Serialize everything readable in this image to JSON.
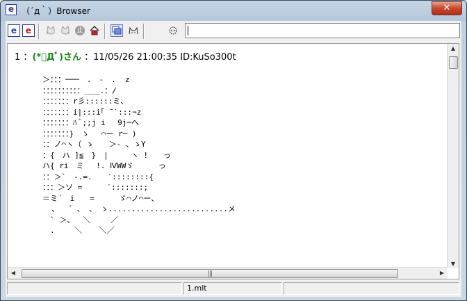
{
  "window": {
    "title": "（´д｀）Browser",
    "close_glyph": "✕",
    "app_icon_glyph": "e"
  },
  "toolbar": {
    "buttons": [
      {
        "name": "open-board-icon",
        "glyph": "e"
      },
      {
        "name": "open-thread-icon",
        "glyph": "e"
      },
      {
        "name": "back-cat-icon"
      },
      {
        "name": "forward-cat-icon"
      },
      {
        "name": "stop-icon",
        "glyph": "止"
      },
      {
        "name": "home-icon"
      },
      {
        "name": "monitor-icon"
      },
      {
        "name": "cat-face-icon"
      },
      {
        "name": "settings-icon"
      }
    ],
    "address_value": ""
  },
  "post": {
    "number": "1",
    "separator": "：",
    "name": "(*ﾟДﾟ)さん",
    "datetime": "11/05/26 21:00:35",
    "id": "ID:KuSo300t"
  },
  "ascii_art": [
    "＞：：：───　.　-　.  z",
    "：：：：：：：：：：＿＿.：/",
    "：：：：：：：r彡::::::ミ、",
    "：：：：：：：i|:::i｢ ¯`:::¬z",
    "：：：：：：：ﾊ ﾞ;;j i　 9j─へ",
    "：：：：：：：}　ゝ　 ⌒ー r─ )",
    "：：ノ⌒ヽ（ ゝ　　＞- 、ゝY",
    "：{　ハ ]≦　}　|　　　ヽ !　　っ",
    "ハ{ ri　ミ　 !. ⅣWWゞ　 　 っ",
    "：：＞`　-.=.　　′::::::::{",
    "：：：＞ソ =　　  ′:::::::;",
    "＝ミ´　i　　=　　  ゞ⌒ノ⌒ー、",
    "  、　 ´ 、 ､　ゝ..........................メ",
    "　` ＞、　 ＼　　 ／",
    "　.　　 ＼ 　 ＼／"
  ],
  "status_bar": {
    "left": "",
    "center": "1.mlt",
    "right": ""
  }
}
